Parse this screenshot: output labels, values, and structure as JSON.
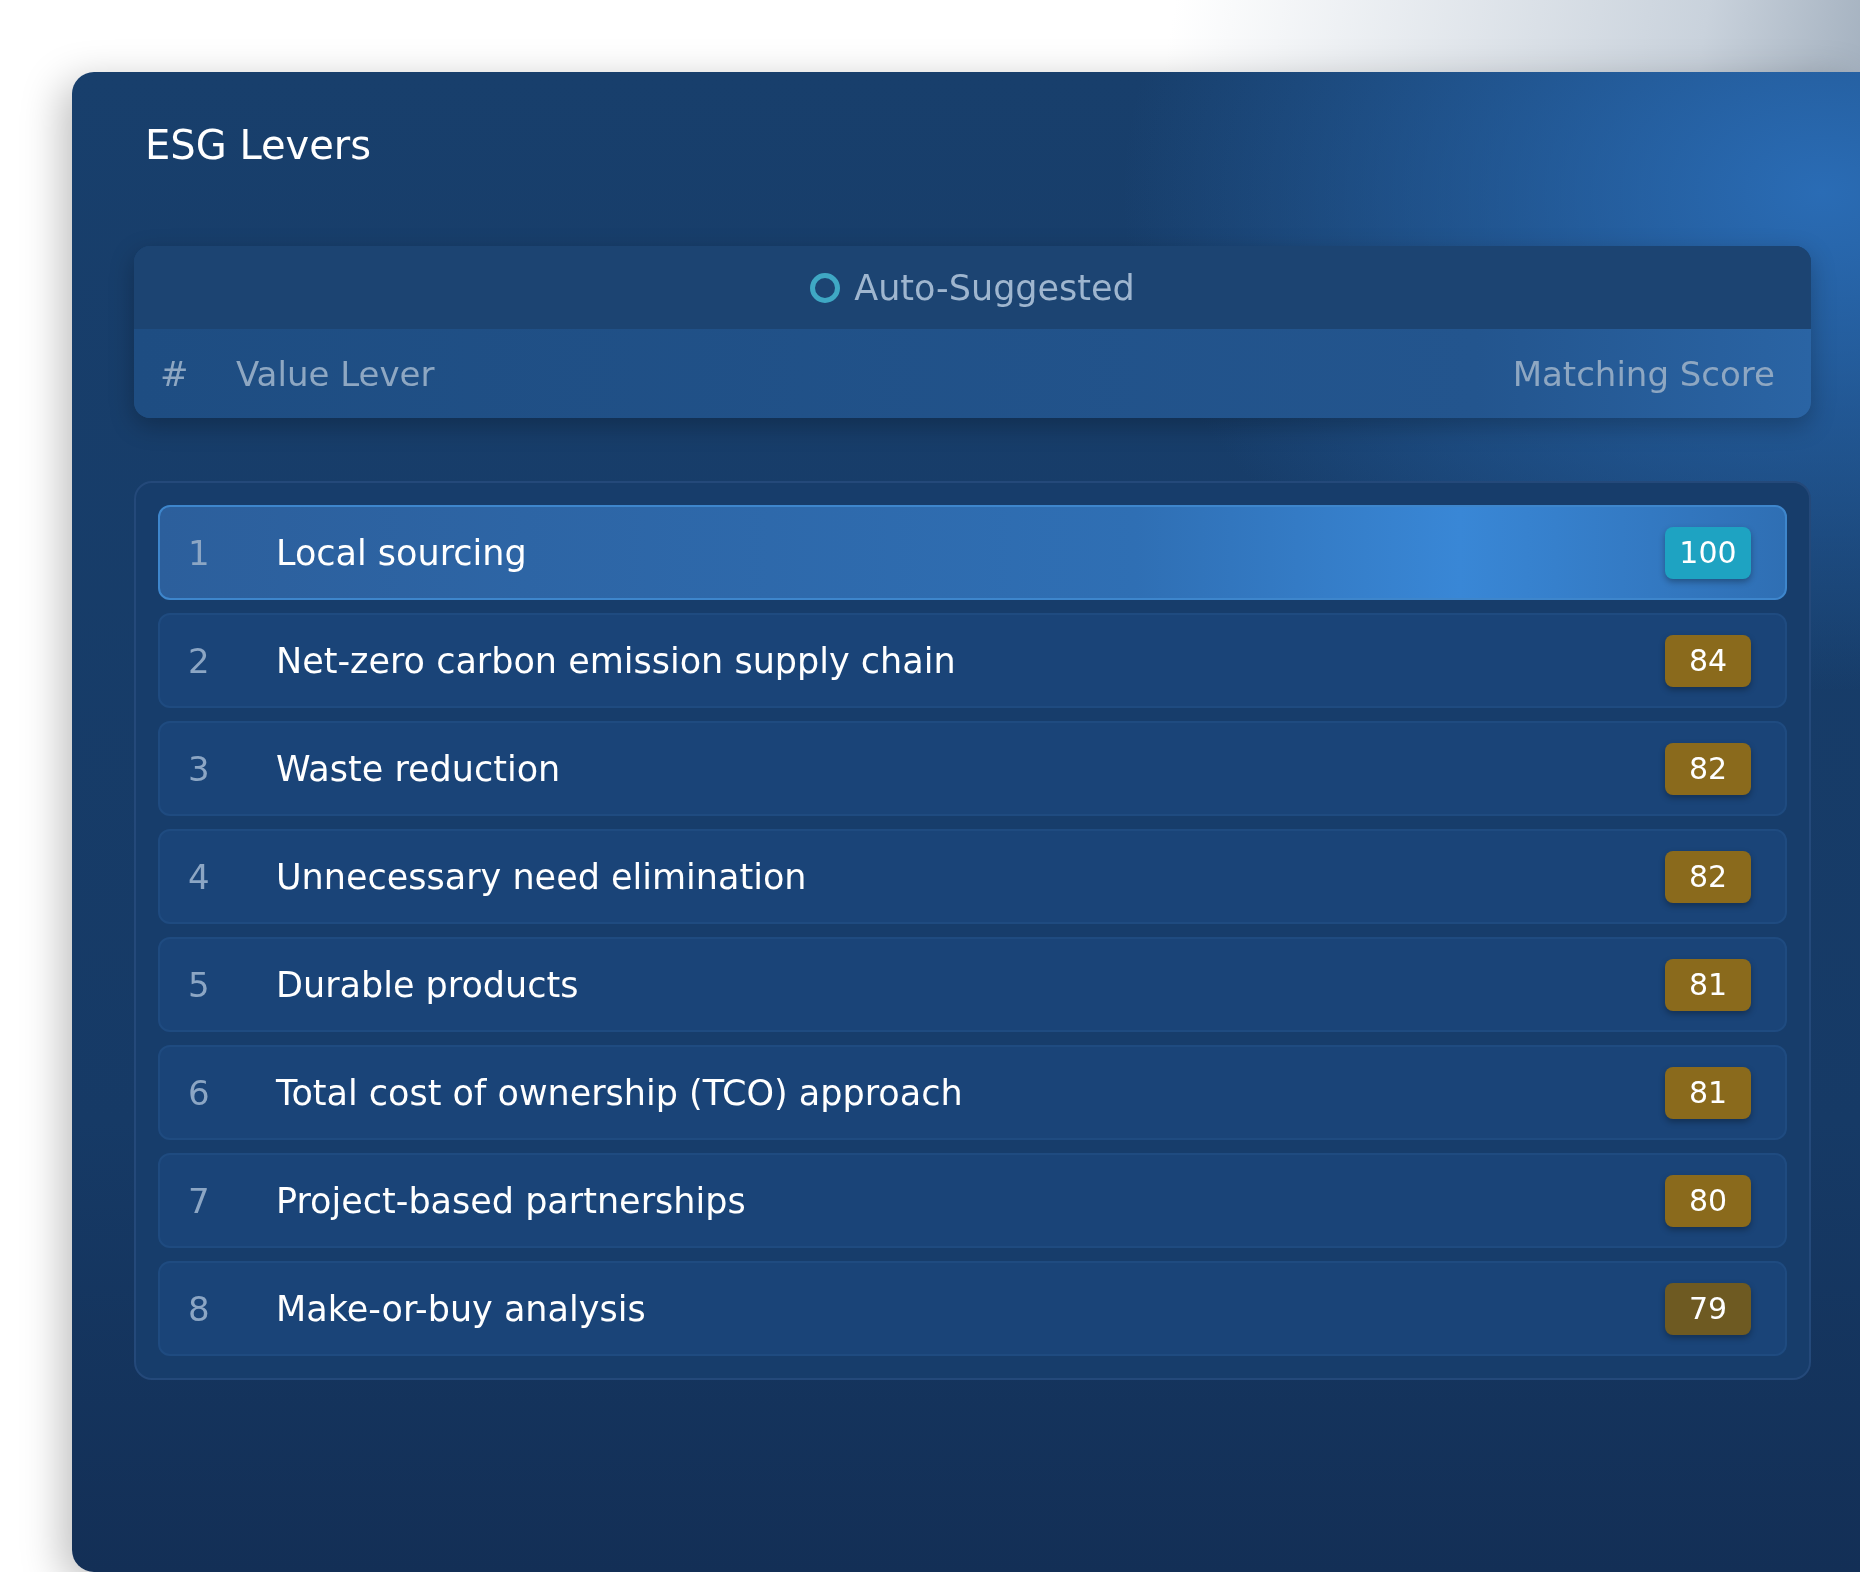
{
  "panel": {
    "title": "ESG Levers"
  },
  "filter": {
    "label": "Auto-Suggested",
    "checked": false
  },
  "columns": {
    "number": "#",
    "lever": "Value Lever",
    "score": "Matching Score"
  },
  "rows": [
    {
      "number": "1",
      "lever": "Local sourcing",
      "score": "100",
      "selected": true,
      "color": "#1ea3c2"
    },
    {
      "number": "2",
      "lever": "Net-zero carbon emission supply chain",
      "score": "84",
      "selected": false,
      "color": "#8a6a1c"
    },
    {
      "number": "3",
      "lever": "Waste reduction",
      "score": "82",
      "selected": false,
      "color": "#8a6a1c"
    },
    {
      "number": "4",
      "lever": "Unnecessary need elimination",
      "score": "82",
      "selected": false,
      "color": "#8a6a1c"
    },
    {
      "number": "5",
      "lever": "Durable products",
      "score": "81",
      "selected": false,
      "color": "#8a6a1c"
    },
    {
      "number": "6",
      "lever": "Total cost of ownership (TCO) approach",
      "score": "81",
      "selected": false,
      "color": "#8a6a1c"
    },
    {
      "number": "7",
      "lever": "Project-based partnerships",
      "score": "80",
      "selected": false,
      "color": "#8a6a1c"
    },
    {
      "number": "8",
      "lever": "Make-or-buy analysis",
      "score": "79",
      "selected": false,
      "color": "#6e5a22"
    }
  ]
}
